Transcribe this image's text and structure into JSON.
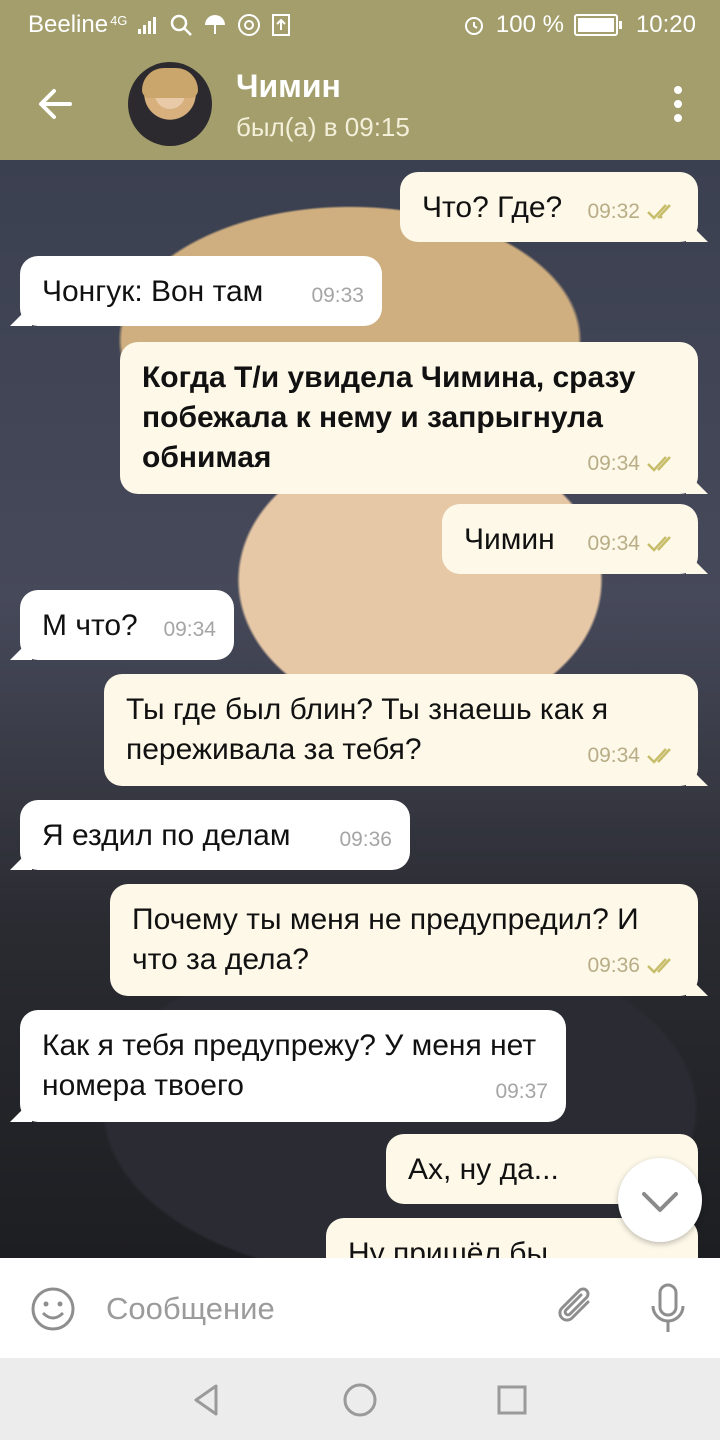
{
  "status_bar": {
    "carrier": "Beeline",
    "network": "4G",
    "battery_percent": "100 %",
    "battery_level": 1.0,
    "time": "10:20",
    "icons": [
      "signal-icon",
      "search-icon",
      "umbrella-icon",
      "at-icon",
      "upload-icon",
      "alarm-icon",
      "battery-icon"
    ]
  },
  "header": {
    "contact_name": "Чимин",
    "contact_status": "был(а) в 09:15",
    "icons": [
      "back-arrow-icon",
      "avatar",
      "more-vert-icon"
    ]
  },
  "messages": [
    {
      "dir": "out",
      "text": "Что? Где?",
      "time": "09:32",
      "read": true
    },
    {
      "dir": "in",
      "text": "Чонгук: Вон там",
      "time": "09:33"
    },
    {
      "dir": "out",
      "text": "Когда Т/и увидела Чимина, сразу побежала к нему и запрыгнула обнимая",
      "time": "09:34",
      "read": true,
      "bold": true
    },
    {
      "dir": "out",
      "text": "Чимин",
      "time": "09:34",
      "read": true
    },
    {
      "dir": "in",
      "text": "М что?",
      "time": "09:34"
    },
    {
      "dir": "out",
      "text": "Ты где был блин? Ты знаешь как я переживала за тебя?",
      "time": "09:34",
      "read": true
    },
    {
      "dir": "in",
      "text": "Я ездил по делам",
      "time": "09:36"
    },
    {
      "dir": "out",
      "text": "Почему ты меня не предупредил? И что за дела?",
      "time": "09:36",
      "read": true
    },
    {
      "dir": "in",
      "text": "Как я тебя предупрежу? У меня нет номера твоего",
      "time": "09:37"
    },
    {
      "dir": "out",
      "text": "Ах, ну да...",
      "time": "09:",
      "read": true
    },
    {
      "dir": "out",
      "text": "Ну пришёл бы",
      "time": "",
      "read": true
    }
  ],
  "input": {
    "placeholder": "Сообщение",
    "icons": [
      "emoji-icon",
      "attach-icon",
      "mic-icon"
    ]
  },
  "nav": {
    "icons": [
      "back-triangle-icon",
      "home-circle-icon",
      "recents-square-icon"
    ]
  },
  "colors": {
    "header": "#a39e6c",
    "out_bubble": "#fdf8e8",
    "in_bubble": "#ffffff",
    "check": "#b8ad5a"
  }
}
